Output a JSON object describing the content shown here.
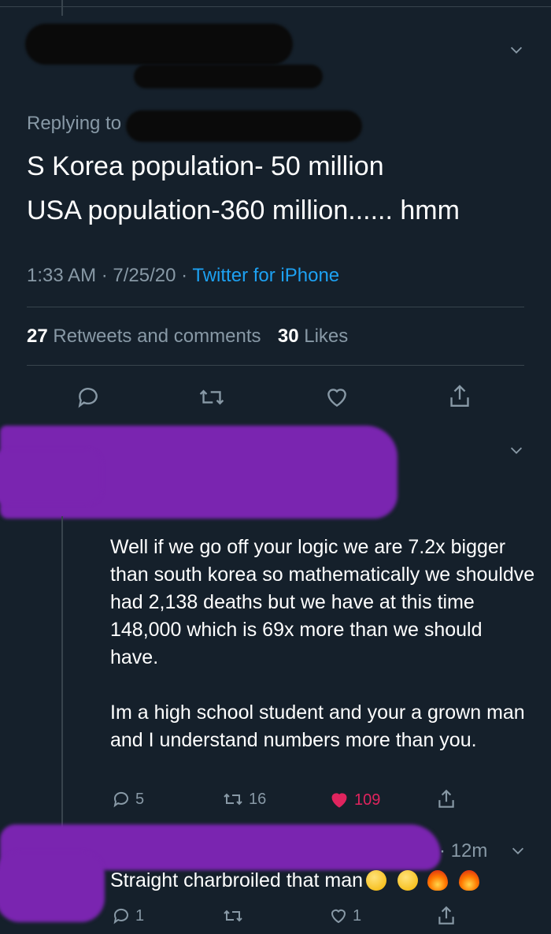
{
  "main_tweet": {
    "replying_to_label": "Replying to",
    "text_line1": "S Korea population- 50 million",
    "text_line2": "USA population-360 million...... hmm",
    "time": "1:33 AM",
    "date": "7/25/20",
    "sep": "·",
    "source": "Twitter for iPhone",
    "retweets_count": "27",
    "retweets_label": "Retweets and comments",
    "likes_count": "30",
    "likes_label": "Likes"
  },
  "reply1": {
    "paragraph1": "Well if we go off your logic we are 7.2x bigger than south korea so mathematically we shouldve had 2,138 deaths but we have at this time 148,000 which is 69x more than we should have.",
    "paragraph2": "Im a high school student and your a grown man and I understand numbers more than you.",
    "reply_count": "5",
    "retweet_count": "16",
    "like_count": "109"
  },
  "reply2": {
    "time": "· 12m",
    "text": "Straight charbroiled that man",
    "reply_count": "1",
    "like_count": "1"
  },
  "colors": {
    "background": "#15202b",
    "muted": "#8899a6",
    "link": "#1da1f2",
    "like_active": "#e0245e",
    "redaction_purple": "#7a25b0"
  },
  "icons": [
    "reply-icon",
    "retweet-icon",
    "heart-icon",
    "share-icon",
    "chevron-down-icon",
    "laughing-emoji",
    "fire-emoji"
  ]
}
